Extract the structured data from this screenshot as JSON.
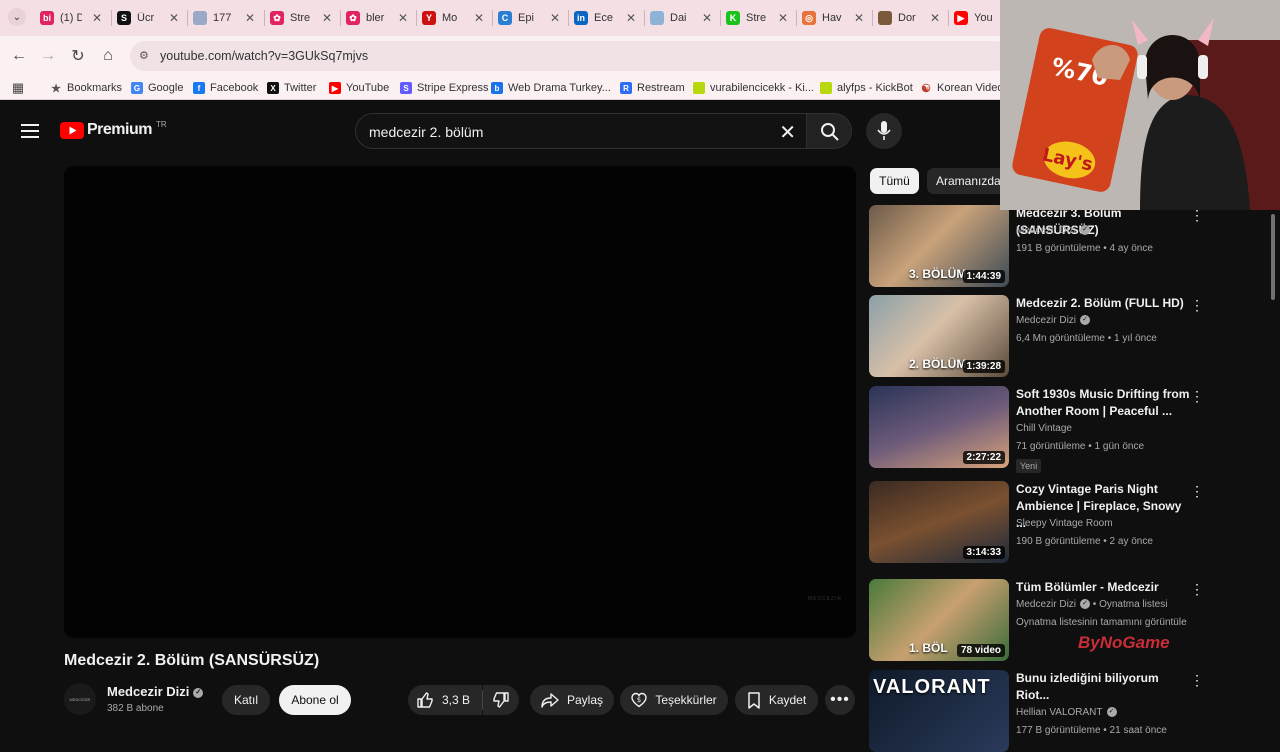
{
  "browser": {
    "tabs": [
      {
        "title": "(1) D",
        "icon": "bi-icon",
        "color": "#e0245e",
        "glyph": "bi"
      },
      {
        "title": "Ücr",
        "icon": "stripe-s-icon",
        "color": "#111111",
        "glyph": "S"
      },
      {
        "title": "177",
        "icon": "globe-icon",
        "color": "#9aa9c7",
        "glyph": ""
      },
      {
        "title": "Stre",
        "icon": "streamlabs-icon",
        "color": "#e0245e",
        "glyph": "✿"
      },
      {
        "title": "bler",
        "icon": "streamlabs-icon",
        "color": "#e0245e",
        "glyph": "✿"
      },
      {
        "title": "Mo",
        "icon": "yandex-icon",
        "color": "#cc1111",
        "glyph": "Y"
      },
      {
        "title": "Epi",
        "icon": "app-icon",
        "color": "#2a7fd4",
        "glyph": "C"
      },
      {
        "title": "Ece",
        "icon": "linkedin-icon",
        "color": "#0a66c2",
        "glyph": "in"
      },
      {
        "title": "Dai",
        "icon": "globe-icon",
        "color": "#8fb3d6",
        "glyph": ""
      },
      {
        "title": "Stre",
        "icon": "kick-icon",
        "color": "#1cc21c",
        "glyph": "K"
      },
      {
        "title": "Hav",
        "icon": "orange-icon",
        "color": "#e8733a",
        "glyph": "◎"
      },
      {
        "title": "Dor",
        "icon": "avatar-icon",
        "color": "#7a5a3a",
        "glyph": ""
      },
      {
        "title": "You",
        "icon": "youtube-icon",
        "color": "#ff0000",
        "glyph": "▶"
      }
    ],
    "url": "youtube.com/watch?v=3GUkSq7mjvs",
    "bookmarks": [
      {
        "label": "Bookmarks",
        "icon": "star-icon",
        "color": "#555555",
        "glyph": "★"
      },
      {
        "label": "Google",
        "icon": "google-icon",
        "color": "#4285f4",
        "glyph": "G"
      },
      {
        "label": "Facebook",
        "icon": "facebook-icon",
        "color": "#1877f2",
        "glyph": "f"
      },
      {
        "label": "Twitter",
        "icon": "x-icon",
        "color": "#111111",
        "glyph": "X"
      },
      {
        "label": "YouTube",
        "icon": "youtube-icon",
        "color": "#ff0000",
        "glyph": "▶"
      },
      {
        "label": "Stripe Express",
        "icon": "stripe-icon",
        "color": "#635bff",
        "glyph": "S"
      },
      {
        "label": "Web Drama Turkey...",
        "icon": "bing-icon",
        "color": "#1a73e8",
        "glyph": "b"
      },
      {
        "label": "Restream",
        "icon": "restream-icon",
        "color": "#2f6df6",
        "glyph": "R"
      },
      {
        "label": "vurabilencicekk - Ki...",
        "icon": "kick-icon",
        "color": "#b7d80c",
        "glyph": ""
      },
      {
        "label": "alyfps - KickBot",
        "icon": "kick-icon",
        "color": "#b7d80c",
        "glyph": ""
      },
      {
        "label": "Korean Videos",
        "icon": "korea-flag-icon",
        "color": "#ffffff",
        "glyph": "☯"
      }
    ]
  },
  "youtube": {
    "logo_text": "Premium",
    "region": "TR",
    "search_query": "medcezir 2. bölüm",
    "video": {
      "title": "Medcezir 2. Bölüm (SANSÜRSÜZ)",
      "channel": "Medcezir Dizi",
      "subscribers": "382 B abone",
      "avatar_text": "MEDCEZIR",
      "watermark": "MEDCEZIR"
    },
    "actions": {
      "join": "Katıl",
      "subscribe": "Abone ol",
      "likes": "3,3 B",
      "share": "Paylaş",
      "thanks": "Teşekkürler",
      "save": "Kaydet"
    },
    "chips": [
      "Tümü",
      "Aramanızda"
    ],
    "recommendations": [
      {
        "title": "Medcezir 3. Bölüm (SANSÜRSÜZ)",
        "channel": "Medcezir Dizi",
        "verified": true,
        "stats": "191 B görüntüleme • 4 ay önce",
        "duration": "1:44:39",
        "overlay": "3. BÖLÜM",
        "thumb": "linear-gradient(135deg,#6b5a4a,#c9a27a 45%,#3c4a55)"
      },
      {
        "title": "Medcezir 2. Bölüm (FULL HD)",
        "channel": "Medcezir Dizi",
        "verified": true,
        "stats": "6,4 Mn görüntüleme • 1 yıl önce",
        "duration": "1:39:28",
        "overlay": "2. BÖLÜM",
        "thumb": "linear-gradient(135deg,#8aa0a8,#d8c0a8 45%,#5a4a3a)"
      },
      {
        "title": "Soft 1930s Music Drifting from Another Room | Peaceful ...",
        "channel": "Chill Vintage",
        "verified": false,
        "stats": "71 görüntüleme • 1 gün önce",
        "badge": "Yeni",
        "duration": "2:27:22",
        "thumb": "linear-gradient(160deg,#2a3456,#6c5a7a 50%,#d8a27a)"
      },
      {
        "title": "Cozy Vintage Paris Night Ambience | Fireplace, Snowy ...",
        "channel": "Sleepy Vintage Room",
        "verified": false,
        "stats": "190 B görüntüleme • 2 ay önce",
        "duration": "3:14:33",
        "thumb": "linear-gradient(160deg,#3a2a22,#7a5030 50%,#1e2a3a)"
      },
      {
        "title": "Tüm Bölümler - Medcezir",
        "channel": "Medcezir Dizi",
        "verified": true,
        "stats": "Oynatma listesi",
        "extra": "Oynatma listesinin tamamını görüntüle",
        "duration": "78 video",
        "overlay": "1. BÖL",
        "thumb": "linear-gradient(135deg,#4a7a3a,#c8a070 50%,#3a6a3a)"
      },
      {
        "title": "Bunu izlediğini biliyorum Riot...",
        "channel": "Hellian VALORANT",
        "verified": true,
        "stats": "177 B görüntüleme • 21 saat önce",
        "overlay": "VALORANT",
        "thumb": "linear-gradient(135deg,#0f1a2a,#2a3a5a)"
      }
    ]
  },
  "overlay": {
    "watermark": "ByNoGame"
  }
}
